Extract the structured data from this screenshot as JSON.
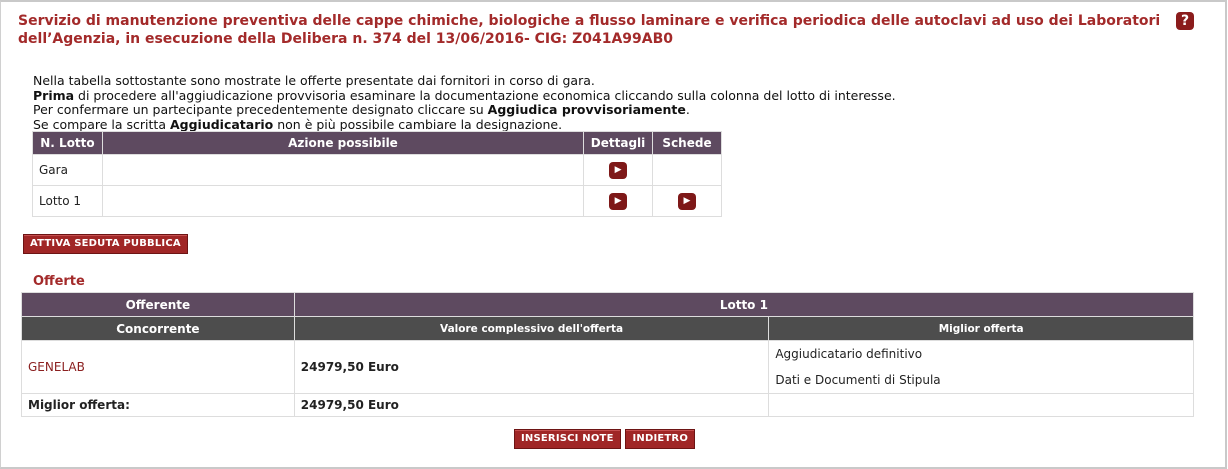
{
  "header": {
    "title": "Servizio di manutenzione preventiva delle cappe chimiche, biologiche a flusso laminare e verifica periodica delle autoclavi ad uso dei Laboratori dell’Agenzia, in esecuzione della Delibera n. 374 del 13/06/2016- CIG: Z041A99AB0",
    "help_glyph": "?"
  },
  "intro": {
    "line1": "Nella tabella sottostante sono mostrate le offerte presentate dai fornitori in corso di gara.",
    "line2_bold": "Prima",
    "line2_rest": " di procedere all'aggiudicazione provvisoria esaminare la documentazione economica cliccando sulla colonna del lotto di interesse.",
    "line3_pre": "Per confermare un partecipante precedentemente designato cliccare su ",
    "line3_bold": "Aggiudica provvisoriamente",
    "line3_post": ".",
    "line4_pre": "Se compare la scritta ",
    "line4_bold": "Aggiudicatario",
    "line4_post": " non è più possibile cambiare la designazione."
  },
  "lots_table": {
    "headers": [
      "N. Lotto",
      "Azione possibile",
      "Dettagli",
      "Schede"
    ],
    "rows": [
      {
        "lotto": "Gara",
        "azione": "",
        "dettagli": true,
        "schede": false
      },
      {
        "lotto": "Lotto 1",
        "azione": "",
        "dettagli": true,
        "schede": true
      }
    ]
  },
  "buttons": {
    "attiva": "ATTIVA SEDUTA PUBBLICA",
    "inserisci_note": "INSERISCI NOTE",
    "indietro": "INDIETRO"
  },
  "offerte": {
    "title": "Offerte",
    "header1": {
      "offerente": "Offerente",
      "lotto": "Lotto 1"
    },
    "header2": {
      "concorrente": "Concorrente",
      "valore": "Valore complessivo dell'offerta",
      "miglior": "Miglior offerta"
    },
    "rows": [
      {
        "concorrente": "GENELAB",
        "valore": "24979,50 Euro",
        "status": "Aggiudicatario definitivo",
        "link": "Dati e Documenti di Stipula"
      }
    ],
    "footer": {
      "label": "Miglior offerta:",
      "valore": "24979,50 Euro"
    }
  },
  "colors": {
    "accent": "#a32a2a",
    "header_bg": "#5e4a60",
    "subheader_bg": "#4d4d4d",
    "button_bg": "#a02626"
  }
}
